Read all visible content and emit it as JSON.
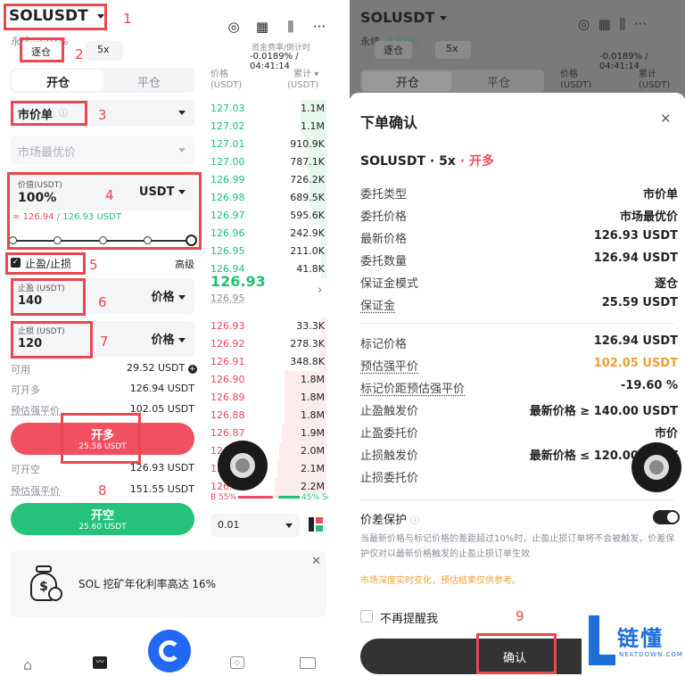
{
  "left": {
    "symbol": "SOLUSDT",
    "perp_label": "永续",
    "change": "-7.01%",
    "margin_mode": "逐仓",
    "leverage": "5x",
    "funding_label": "资金费率/倒计时",
    "funding_value": "-0.0189% / 04:41:14",
    "tab_open": "开仓",
    "tab_close": "平仓",
    "order_type": "市价单",
    "market_price_placeholder": "市场最优价",
    "value_label": "价值(USDT)",
    "value_input": "100%",
    "value_unit": "USDT",
    "price_range_a": "126.94",
    "price_range_b": "126.93 USDT",
    "tpsl_label": "止盈/止损",
    "advanced": "高级",
    "tp_label": "止盈 (USDT)",
    "tp_value": "140",
    "tp_price_type": "价格",
    "sl_label": "止损 (USDT)",
    "sl_value": "120",
    "sl_price_type": "价格",
    "available_label": "可用",
    "available_value": "29.52 USDT",
    "can_long_label": "可开多",
    "can_long_value": "126.94 USDT",
    "liq_long_label": "预估强平价",
    "liq_long_value": "102.05 USDT",
    "long_btn": "开多",
    "long_btn_sub": "25.58 USDT",
    "can_short_label": "可开空",
    "can_short_value": "126.93 USDT",
    "liq_short_label": "预估强平价",
    "liq_short_value": "151.55 USDT",
    "short_btn": "开空",
    "short_btn_sub": "25.60 USDT",
    "book_price_header": "价格",
    "book_price_unit": "(USDT)",
    "book_total_header": "累计",
    "book_total_unit": "(USDT)",
    "asks": [
      {
        "p": "127.03",
        "q": "1.1M"
      },
      {
        "p": "127.02",
        "q": "1.1M"
      },
      {
        "p": "127.01",
        "q": "910.9K"
      },
      {
        "p": "127.00",
        "q": "787.1K"
      },
      {
        "p": "126.99",
        "q": "726.2K"
      },
      {
        "p": "126.98",
        "q": "689.5K"
      },
      {
        "p": "126.97",
        "q": "595.6K"
      },
      {
        "p": "126.96",
        "q": "242.9K"
      },
      {
        "p": "126.95",
        "q": "211.0K"
      },
      {
        "p": "126.94",
        "q": "41.8K"
      }
    ],
    "last_price": "126.93",
    "mark_price": "126.95",
    "bids": [
      {
        "p": "126.93",
        "q": "33.3K"
      },
      {
        "p": "126.92",
        "q": "278.3K"
      },
      {
        "p": "126.91",
        "q": "348.8K"
      },
      {
        "p": "126.90",
        "q": "1.8M"
      },
      {
        "p": "126.89",
        "q": "1.8M"
      },
      {
        "p": "126.88",
        "q": "1.8M"
      },
      {
        "p": "126.87",
        "q": "1.9M"
      },
      {
        "p": "126.86",
        "q": "2.0M"
      },
      {
        "p": "126.85",
        "q": "2.1M"
      },
      {
        "p": "126.84",
        "q": "2.2M"
      }
    ],
    "ratio_buy": "B 55%",
    "ratio_sell": "45% S",
    "precision": "0.01",
    "promo_text": "SOL 挖矿年化利率高达 16%",
    "annotations": [
      "1",
      "2",
      "3",
      "4",
      "5",
      "6",
      "7",
      "8"
    ]
  },
  "right": {
    "title": "下单确认",
    "symbol": "SOLUSDT",
    "leverage": "5x",
    "side": "开多",
    "rows": [
      {
        "k": "委托类型",
        "v": "市价单"
      },
      {
        "k": "委托价格",
        "v": "市场最优价"
      },
      {
        "k": "最新价格",
        "v": "126.93 USDT"
      },
      {
        "k": "委托数量",
        "v": "126.94 USDT"
      },
      {
        "k": "保证金模式",
        "v": "逐仓"
      },
      {
        "k": "保证金",
        "v": "25.59 USDT"
      }
    ],
    "rows2": [
      {
        "k": "标记价格",
        "v": "126.94 USDT"
      },
      {
        "k": "预估强平价",
        "v": "102.05 USDT"
      },
      {
        "k": "标记价距预估强平价",
        "v": "-19.60 %"
      },
      {
        "k": "止盈触发价",
        "v": "最新价格 ≥ 140.00 USDT"
      },
      {
        "k": "止盈委托价",
        "v": "市价"
      },
      {
        "k": "止损触发价",
        "v": "最新价格 ≤ 120.00 USDT"
      },
      {
        "k": "止损委托价",
        "v": "市价"
      }
    ],
    "spread_label": "价差保护",
    "spread_desc": "当最新价格与标记价格的差距超过10%时，止盈止损订单将不会被触发，价差保护仅对以最新价格触发的止盈止损订单生效",
    "warning": "市场深度实时变化，预估结果仅供参考。",
    "no_remind": "不再提醒我",
    "confirm": "确认",
    "annotation": "9",
    "bg_symbol": "SOLUSDT",
    "bg_change": "-7.01%",
    "bg_perp": "永续"
  },
  "watermark": {
    "text": "链懂",
    "sub": "NEATDOWN.COM"
  },
  "colors": {
    "long": "#f0505f",
    "short": "#25c27c",
    "annotation": "#e8484f",
    "accent_orange": "#f0a030"
  }
}
